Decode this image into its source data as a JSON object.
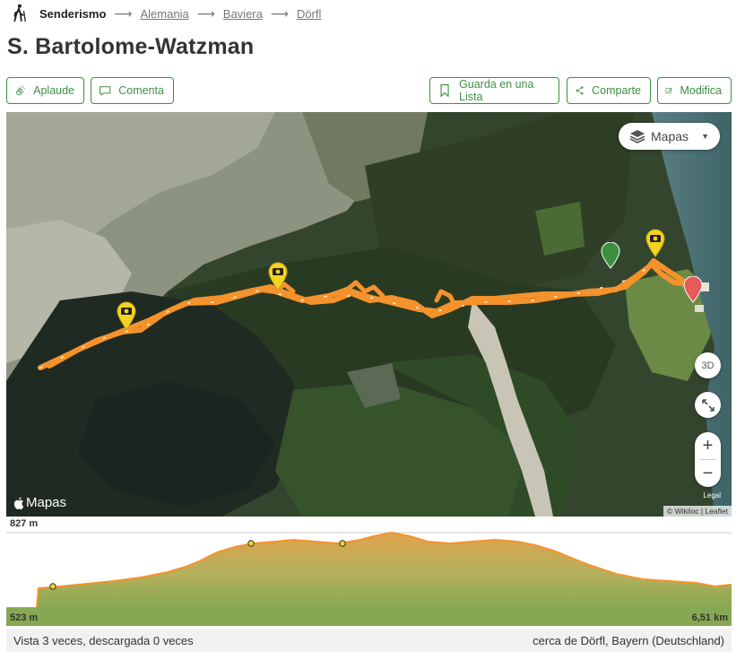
{
  "breadcrumb": {
    "activity": "Senderismo",
    "sep": "⟶",
    "items": [
      "Alemania",
      "Baviera",
      "Dörfl"
    ]
  },
  "title": "S. Bartolome-Watzman",
  "actions": {
    "applaud": "Aplaude",
    "comment": "Comenta",
    "save_list": "Guarda en una Lista",
    "share": "Comparte",
    "edit": "Modifica"
  },
  "map": {
    "layers_label": "Mapas",
    "controls": {
      "three_d": "3D",
      "zoom_in": "+",
      "zoom_out": "−"
    },
    "apple_label": "Mapas",
    "legal": "Legal",
    "attribution": "© Wikiloc | Leaflet",
    "route_color": "#f5922b",
    "start_marker_color": "#3c8f3f",
    "end_marker_color": "#e85a5a",
    "photo_marker_color": "#f4d321"
  },
  "elevation": {
    "max_label": "827 m",
    "min_label": "523 m",
    "distance_label": "6,51 km",
    "fill_color": "#a9ae5a",
    "line_color": "#f5922b"
  },
  "stats": {
    "views": "Vista 3 veces, descargada 0 veces",
    "location": "cerca de Dörfl, Bayern (Deutschland)"
  },
  "colors": {
    "accent": "#3f8f44"
  }
}
